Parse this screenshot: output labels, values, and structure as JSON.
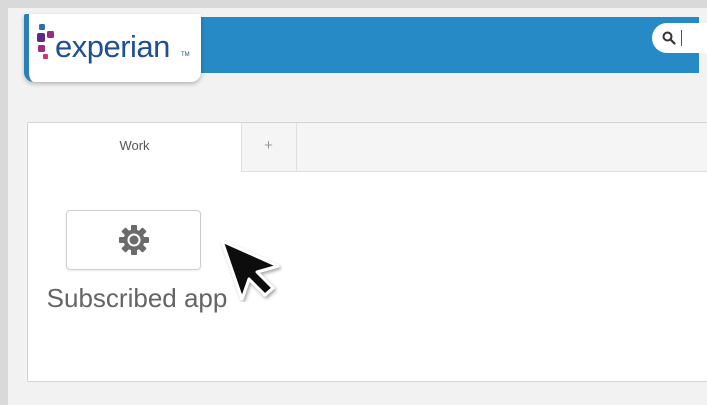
{
  "header": {
    "logo_text": "experian",
    "logo_tm": "TM",
    "brand_color": "#258ac6",
    "logo_color": "#1d4f91",
    "search": {
      "icon": "search-icon"
    }
  },
  "workspace": {
    "tabs": [
      {
        "label": "Work",
        "active": true
      },
      {
        "label": "+",
        "active": false
      }
    ],
    "apps": [
      {
        "icon": "gear-icon",
        "caption": "Subscribed app"
      }
    ]
  },
  "annotation": {
    "icon": "arrow-cursor-icon"
  }
}
